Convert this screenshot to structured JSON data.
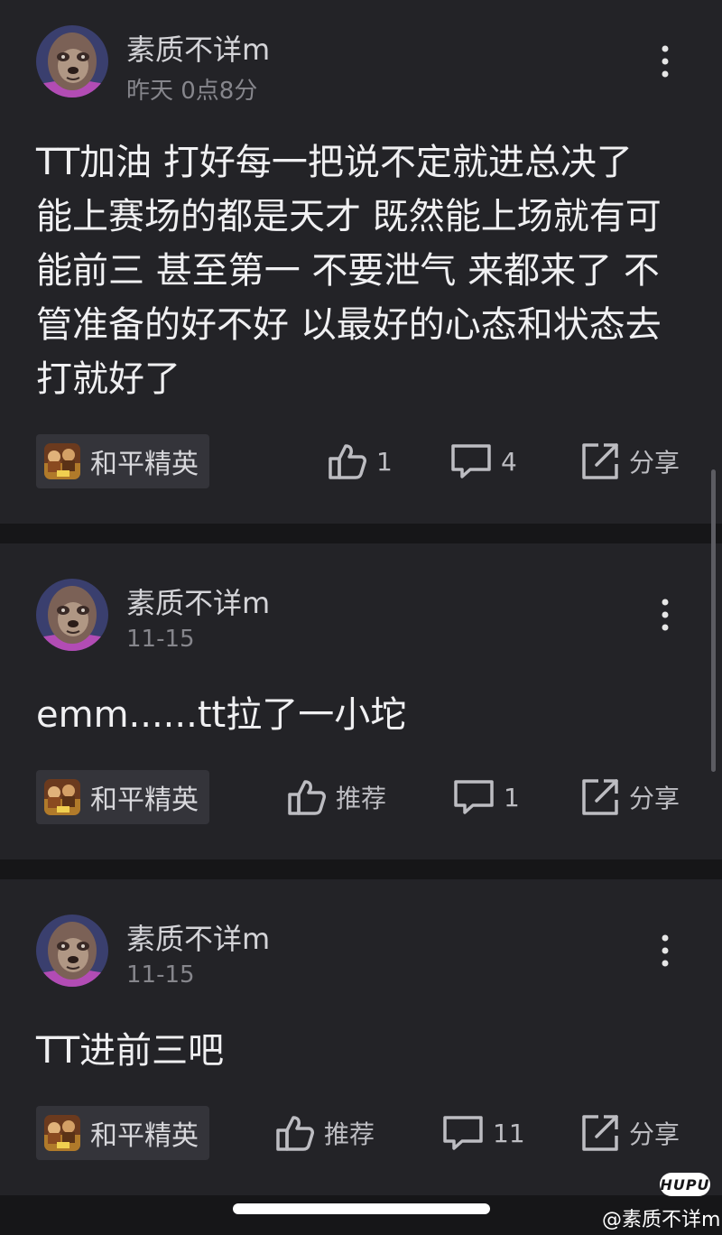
{
  "comments": [
    {
      "username": "素质不详m",
      "timestamp": "昨天 0点8分",
      "content_lines": [
        "TT加油 打好每一把说不定就进总决了",
        "能上赛场的都是天才 既然能上场就有可",
        "能前三 甚至第一 不要泄气 来都来了 不",
        "管准备的好不好 以最好的心态和状态去",
        "打就好了"
      ],
      "tag": "和平精英",
      "like_label": "1",
      "reply_count": "4",
      "share_label": "分享"
    },
    {
      "username": "素质不详m",
      "timestamp": "11-15",
      "content_lines": [
        "emm......tt拉了一小坨"
      ],
      "tag": "和平精英",
      "like_label": "推荐",
      "reply_count": "1",
      "share_label": "分享"
    },
    {
      "username": "素质不详m",
      "timestamp": "11-15",
      "content_lines": [
        "TT进前三吧"
      ],
      "tag": "和平精英",
      "like_label": "推荐",
      "reply_count": "11",
      "share_label": "分享"
    }
  ],
  "watermark": {
    "logo": "HUPU",
    "text": "@素质不详m"
  },
  "icons": {
    "avatar": "sloth-avatar-icon",
    "more": "more-vertical-icon",
    "tag": "game-tag-icon",
    "like": "thumb-up-icon",
    "reply": "comment-icon",
    "share": "share-icon"
  },
  "colors": {
    "background": "#161618",
    "card": "#232327",
    "text_primary": "#f0f0f2",
    "text_secondary": "#86868c",
    "tag_background": "#34343a"
  }
}
